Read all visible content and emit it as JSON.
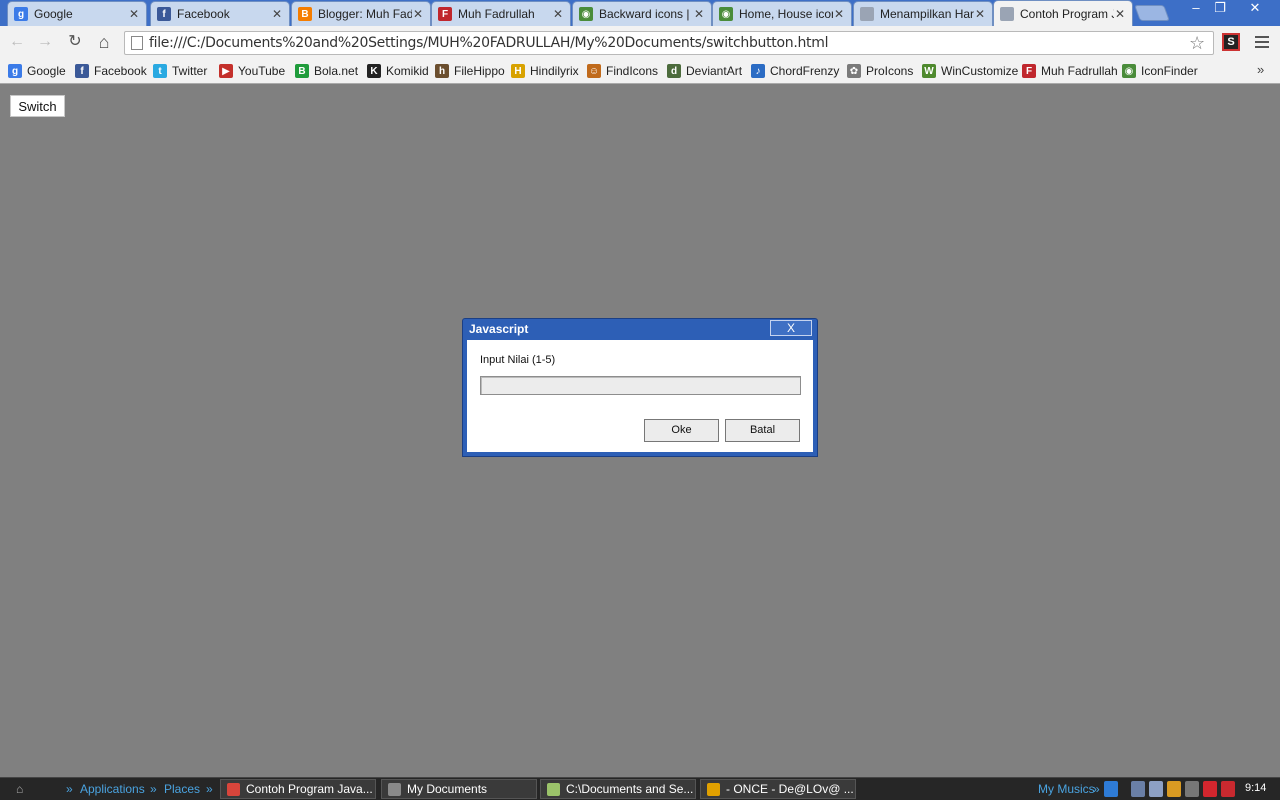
{
  "tabs": [
    {
      "title": "Google",
      "icon": "google-icon",
      "color": "#3b7be8",
      "glyph": "g"
    },
    {
      "title": "Facebook",
      "icon": "facebook-icon",
      "color": "#3b5998",
      "glyph": "f"
    },
    {
      "title": "Blogger: Muh Fadr",
      "icon": "blogger-icon",
      "color": "#f57d00",
      "glyph": "B"
    },
    {
      "title": "Muh Fadrullah",
      "icon": "fadrullah-icon",
      "color": "#c0272d",
      "glyph": "F"
    },
    {
      "title": "Backward icons | I",
      "icon": "iconfinder-icon",
      "color": "#4a8c3a",
      "glyph": "◉"
    },
    {
      "title": "Home, House icon",
      "icon": "iconfinder-icon",
      "color": "#4a8c3a",
      "glyph": "◉"
    },
    {
      "title": "Menampilkan Hari",
      "icon": "page-icon",
      "color": "#9aa4b4",
      "glyph": ""
    },
    {
      "title": "Contoh Program J",
      "icon": "page-icon",
      "color": "#9aa4b4",
      "glyph": ""
    }
  ],
  "window_controls": {
    "minimize": "–",
    "restore": "❐",
    "close": "✕"
  },
  "toolbar": {
    "back": "←",
    "forward": "→",
    "reload": "↻",
    "home": "⌂",
    "url": "file:///C:/Documents%20and%20Settings/MUH%20FADRULLAH/My%20Documents/switchbutton.html",
    "star": "☆",
    "ext_glyph": "S"
  },
  "bookmarks": [
    {
      "label": "Google",
      "icon": "google-icon",
      "color": "#3b7be8",
      "glyph": "g"
    },
    {
      "label": "Facebook",
      "icon": "facebook-icon",
      "color": "#3b5998",
      "glyph": "f"
    },
    {
      "label": "Twitter",
      "icon": "twitter-icon",
      "color": "#29a9e1",
      "glyph": "t"
    },
    {
      "label": "YouTube",
      "icon": "youtube-icon",
      "color": "#c4302b",
      "glyph": "▶"
    },
    {
      "label": "Bola.net",
      "icon": "bola-icon",
      "color": "#1f9c3b",
      "glyph": "B"
    },
    {
      "label": "Komikid",
      "icon": "komikid-icon",
      "color": "#222222",
      "glyph": "K"
    },
    {
      "label": "FileHippo",
      "icon": "filehippo-icon",
      "color": "#6b4e2e",
      "glyph": "h"
    },
    {
      "label": "Hindilyrix",
      "icon": "hindilyrix-icon",
      "color": "#d8a200",
      "glyph": "H"
    },
    {
      "label": "FindIcons",
      "icon": "findicons-icon",
      "color": "#c06a1b",
      "glyph": "☺"
    },
    {
      "label": "DeviantArt",
      "icon": "deviantart-icon",
      "color": "#4c6b3c",
      "glyph": "d"
    },
    {
      "label": "ChordFrenzy",
      "icon": "chordfrenzy-icon",
      "color": "#2b6cc4",
      "glyph": "♪"
    },
    {
      "label": "ProIcons",
      "icon": "proicons-icon",
      "color": "#7a7a7a",
      "glyph": "✿"
    },
    {
      "label": "WinCustomize",
      "icon": "wincustomize-icon",
      "color": "#4f8a2e",
      "glyph": "W"
    },
    {
      "label": "Muh Fadrullah",
      "icon": "fadrullah-icon",
      "color": "#c0272d",
      "glyph": "F"
    },
    {
      "label": "IconFinder",
      "icon": "iconfinder-icon",
      "color": "#4a8c3a",
      "glyph": "◉"
    }
  ],
  "bookmarks_overflow": "»",
  "page": {
    "switch_label": "Switch"
  },
  "dialog": {
    "title": "Javascript",
    "close": "X",
    "prompt": "Input Nilai (1-5)",
    "input_value": "",
    "ok_label": "Oke",
    "cancel_label": "Batal"
  },
  "taskbar": {
    "start_glyph": "⌂",
    "applications": "Applications",
    "places": "Places",
    "items": [
      {
        "label": "Contoh Program Java...",
        "icon": "chrome-icon",
        "color": "#d8453b"
      },
      {
        "label": "My Documents",
        "icon": "folder-icon",
        "color": "#8a8a8a"
      },
      {
        "label": "C:\\Documents and Se...",
        "icon": "notepad-icon",
        "color": "#9bc36a"
      },
      {
        "label": "- ONCE - De@LOv@ ...",
        "icon": "winamp-icon",
        "color": "#e0a000"
      }
    ],
    "music": "My Musics",
    "clock": "9:14"
  }
}
